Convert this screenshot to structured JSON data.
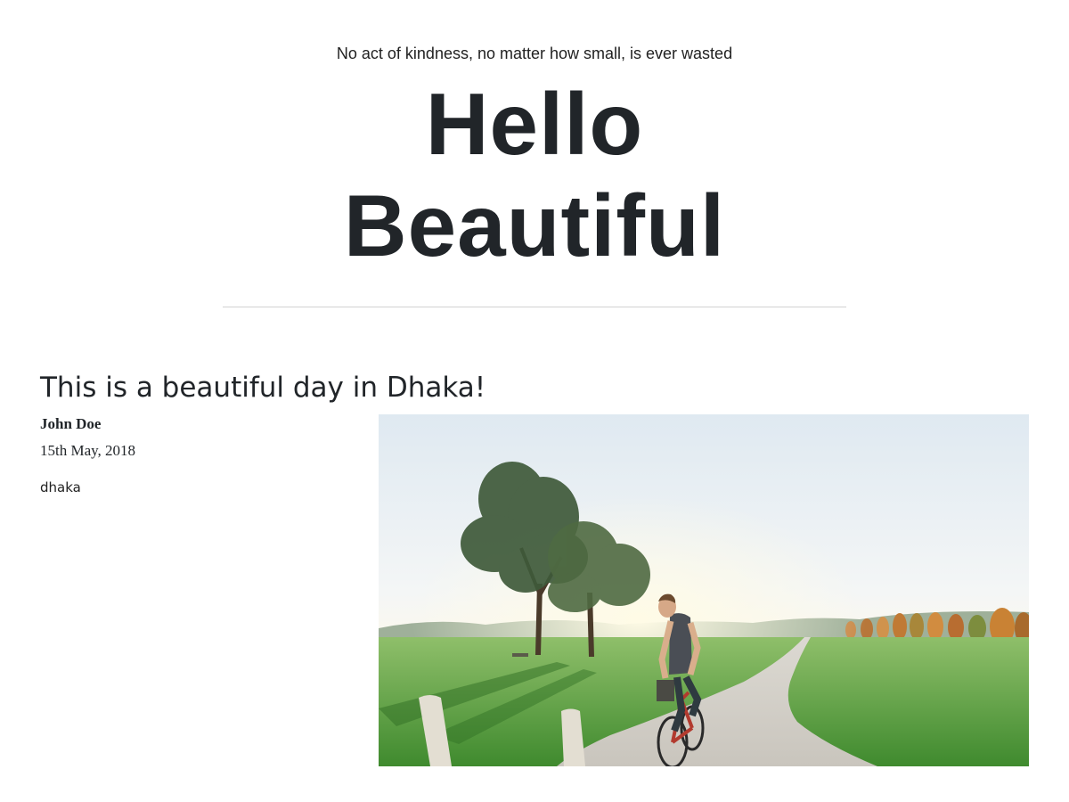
{
  "hero": {
    "tagline": "No act of kindness, no matter how small, is ever wasted",
    "title_line1": "Hello",
    "title_line2": "Beautiful"
  },
  "post": {
    "title": "This is a beautiful day in Dhaka!",
    "author": "John Doe",
    "date": "15th May, 2018",
    "tag": "dhaka",
    "image_subject": "man riding a red bicycle on a gravel path through a sunny park with trees"
  },
  "colors": {
    "text": "#212529",
    "divider": "#d2d2d2"
  }
}
